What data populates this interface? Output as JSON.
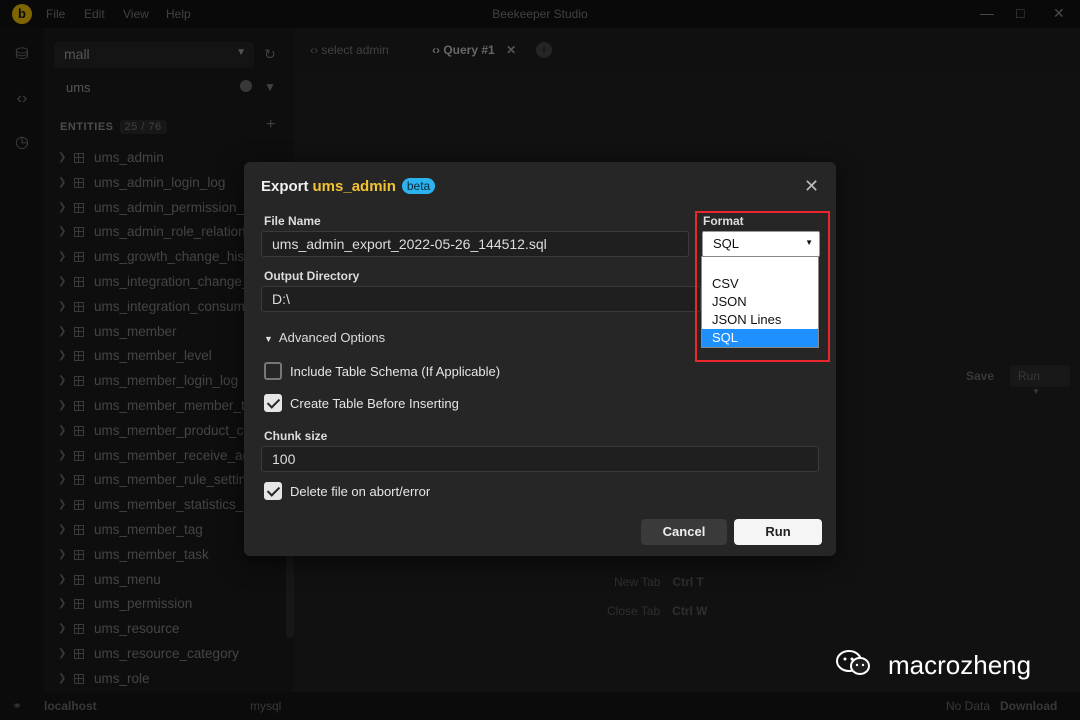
{
  "titlebar": {
    "app_title": "Beekeeper Studio",
    "menu": [
      "File",
      "Edit",
      "View",
      "Help"
    ],
    "logo_letter": "b"
  },
  "sidebar": {
    "connection": "mall",
    "filter_value": "ums",
    "entities_label": "ENTITIES",
    "entities_count": "25 / 76",
    "tables": [
      "ums_admin",
      "ums_admin_login_log",
      "ums_admin_permission_relation",
      "ums_admin_role_relation",
      "ums_growth_change_history",
      "ums_integration_change_history",
      "ums_integration_consume_setting",
      "ums_member",
      "ums_member_level",
      "ums_member_login_log",
      "ums_member_member_tag_relation",
      "ums_member_product_category_relation",
      "ums_member_receive_address",
      "ums_member_rule_setting",
      "ums_member_statistics_info",
      "ums_member_tag",
      "ums_member_task",
      "ums_menu",
      "ums_permission",
      "ums_resource",
      "ums_resource_category",
      "ums_role"
    ]
  },
  "tabs": [
    {
      "label": "select admin",
      "icon": "code-icon"
    },
    {
      "label": "Query #1",
      "icon": "code-icon"
    }
  ],
  "editor": {
    "save_label": "Save",
    "run_label": "Run",
    "shortcuts": [
      {
        "label": "New Tab",
        "keys": "Ctrl  T"
      },
      {
        "label": "Close Tab",
        "keys": "Ctrl  W"
      }
    ]
  },
  "statusbar": {
    "connection": "localhost",
    "db_type": "mysql",
    "no_data": "No Data",
    "download": "Download"
  },
  "modal": {
    "title_prefix": "Export",
    "table_name": "ums_admin",
    "badge": "beta",
    "file_name_label": "File Name",
    "file_name_value": "ums_admin_export_2022-05-26_144512.sql",
    "output_dir_label": "Output Directory",
    "output_dir_value": "D:\\",
    "format_label": "Format",
    "format_selected": "SQL",
    "format_options": [
      "",
      "CSV",
      "JSON",
      "JSON Lines",
      "SQL"
    ],
    "advanced_label": "Advanced Options",
    "include_schema_label": "Include Table Schema (If Applicable)",
    "include_schema_checked": false,
    "create_table_label": "Create Table Before Inserting",
    "create_table_checked": true,
    "chunk_size_label": "Chunk size",
    "chunk_size_value": "100",
    "delete_on_abort_label": "Delete file on abort/error",
    "delete_on_abort_checked": true,
    "cancel_label": "Cancel",
    "run_label": "Run"
  },
  "watermark": {
    "text": "macrozheng"
  },
  "colors": {
    "accent_table_name": "#f2c230",
    "beta_badge": "#2bb3f0",
    "highlight_box": "#e8262c",
    "selected_option": "#1e90ff"
  }
}
